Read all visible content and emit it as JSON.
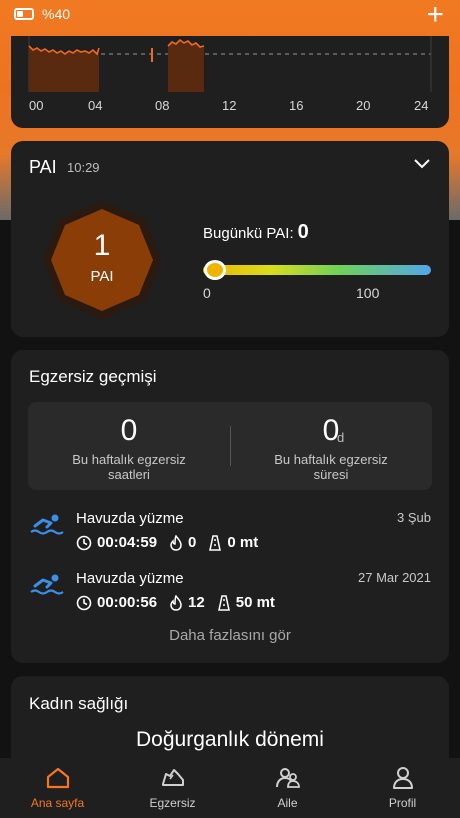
{
  "status_bar": {
    "battery_label": "%40",
    "battery_level": 0.4,
    "add_icon": "plus-icon"
  },
  "sleep_chart": {
    "x_ticks": [
      "00",
      "04",
      "08",
      "12",
      "16",
      "20",
      "24"
    ],
    "accent_color": "#f06a1e"
  },
  "pai": {
    "title": "PAI",
    "time": "10:29",
    "value": "1",
    "unit": "PAI",
    "today_label": "Bugünkü PAI:",
    "today_value": "0",
    "scale_min": "0",
    "scale_max": "100",
    "slider_level": 0,
    "badge_color": "#8a3d07"
  },
  "exercise_history": {
    "title": "Egzersiz geçmişi",
    "weekly_hours": {
      "value": "0",
      "label": "Bu haftalık egzersiz saatleri"
    },
    "weekly_duration": {
      "value": "0",
      "unit": "d",
      "label": "Bu haftalık egzersiz süresi"
    },
    "activities": [
      {
        "name": "Havuzda yüzme",
        "date": "3 Şub",
        "duration": "00:04:59",
        "calories": "0",
        "distance": "0 mt",
        "icon": "swimmer-icon"
      },
      {
        "name": "Havuzda yüzme",
        "date": "27 Mar 2021",
        "duration": "00:00:56",
        "calories": "12",
        "distance": "50 mt",
        "icon": "swimmer-icon"
      }
    ],
    "see_more": "Daha fazlasını gör"
  },
  "womens_health": {
    "title": "Kadın sağlığı",
    "phase": "Doğurganlık dönemi"
  },
  "nav": {
    "items": [
      {
        "label": "Ana sayfa",
        "icon": "home-icon",
        "active": true
      },
      {
        "label": "Egzersiz",
        "icon": "shoe-icon",
        "active": false
      },
      {
        "label": "Aile",
        "icon": "family-icon",
        "active": false
      },
      {
        "label": "Profil",
        "icon": "profile-icon",
        "active": false
      }
    ],
    "active_color": "#f5761f"
  }
}
